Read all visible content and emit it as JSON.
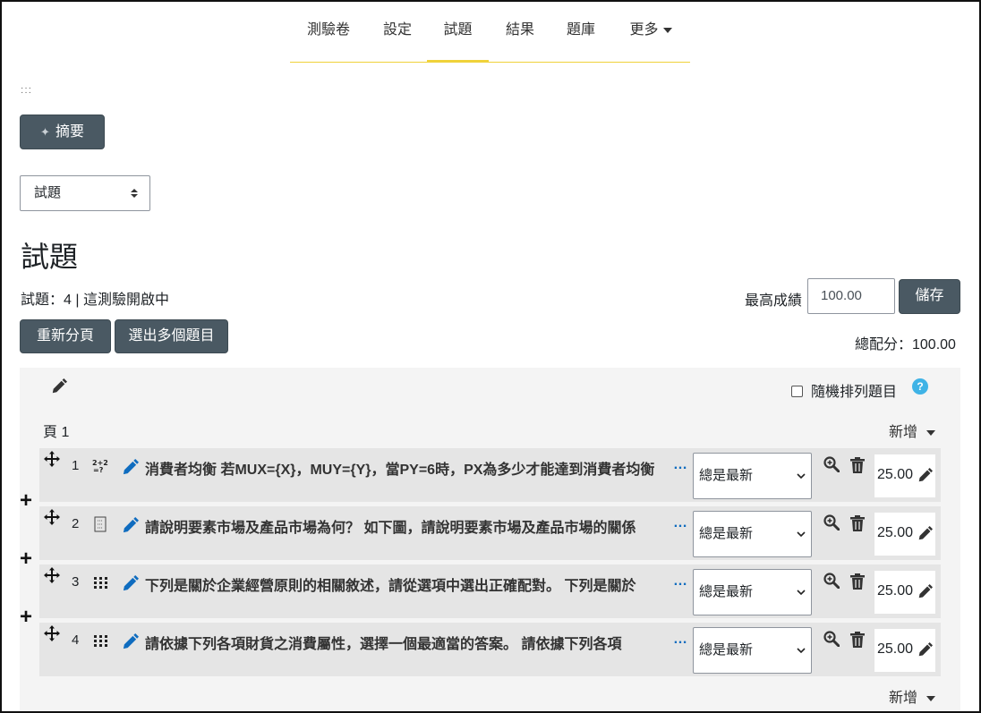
{
  "nav": {
    "tabs": [
      "測驗卷",
      "設定",
      "試題",
      "結果",
      "題庫"
    ],
    "more": "更多",
    "active_index": 2
  },
  "toolbar": {
    "summary_label": "摘要",
    "view_select": "試題"
  },
  "page_title": "試題",
  "info_line": "試題：4 | 這測驗開啟中",
  "max_grade": {
    "label": "最高成績",
    "value": "100.00",
    "save_label": "儲存"
  },
  "buttons": {
    "repaginate": "重新分頁",
    "select_multiple": "選出多個題目"
  },
  "total_marks": "總配分：100.00",
  "section": {
    "shuffle_label": "隨機排列題目",
    "help": "?",
    "page_label": "頁 1",
    "add_label": "新增"
  },
  "questions": [
    {
      "num": "1",
      "type": "calculated",
      "text": "消費者均衡 若MUX={X}，MUY={Y}，當PY=6時，PX為多少才能達到消費者均衡",
      "version": "總是最新",
      "mark": "25.00"
    },
    {
      "num": "2",
      "type": "essay",
      "text": "請說明要素市場及產品市場為何？ 如下圖，請說明要素市場及產品市場的關係",
      "version": "總是最新",
      "mark": "25.00"
    },
    {
      "num": "3",
      "type": "matching",
      "text": "下列是關於企業經營原則的相關敘述，請從選項中選出正確配對。 下列是關於",
      "version": "總是最新",
      "mark": "25.00"
    },
    {
      "num": "4",
      "type": "matching",
      "text": "請依據下列各項財貨之消費屬性，選擇一個最適當的答案。 請依據下列各項",
      "version": "總是最新",
      "mark": "25.00"
    }
  ],
  "more_glyph": "…",
  "plus_glyph": "+"
}
